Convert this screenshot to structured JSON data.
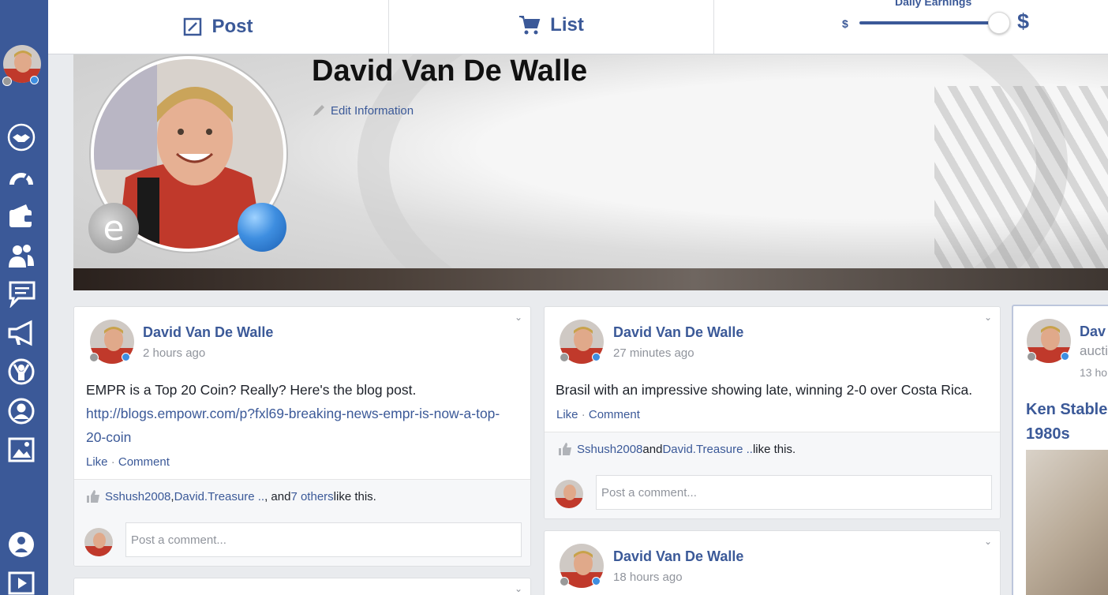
{
  "topbar": {
    "post_label": "Post",
    "list_label": "List",
    "earnings_label": "Daily Earnings",
    "earnings_min": "$",
    "earnings_max": "$",
    "earnings_level": 0.93,
    "accent": "#3b5998"
  },
  "sidebar": {
    "items": [
      {
        "icon": "handshake-icon"
      },
      {
        "icon": "gauge-icon"
      },
      {
        "icon": "wallet-icon"
      },
      {
        "icon": "friends-icon"
      },
      {
        "icon": "chat-icon"
      },
      {
        "icon": "megaphone-icon"
      },
      {
        "icon": "celebrate-icon"
      },
      {
        "icon": "profile-icon"
      },
      {
        "icon": "image-icon"
      },
      {
        "icon": "help-icon"
      },
      {
        "icon": "video-icon"
      }
    ]
  },
  "profile": {
    "name": "David Van De Walle",
    "edit_label": "Edit Information",
    "badge_letter": "e"
  },
  "posts": [
    {
      "author": "David Van De Walle",
      "time": "2 hours ago",
      "text": "EMPR is a Top 20 Coin? Really? Here's the blog post.",
      "link": "http://blogs.empowr.com/p?fxl69-breaking-news-empr-is-now-a-top-20-coin",
      "like": "Like",
      "comment": "Comment",
      "likers_a": "Sshush2008",
      "likers_b": "David.Treasure ..",
      "likers_mid": ", ",
      "likers_and": ", and ",
      "likers_others": "7 others",
      "likers_tail": " like this.",
      "comment_placeholder": "Post a comment..."
    },
    {
      "author": "David Van De Walle",
      "time": "27 minutes ago",
      "text": "Brasil with an impressive showing late, winning 2-0 over Costa Rica.",
      "like": "Like",
      "comment": "Comment",
      "likers_a": "Sshush2008",
      "likers_and": " and ",
      "likers_b": "David.Treasure ..",
      "likers_tail": " like this.",
      "comment_placeholder": "Post a comment..."
    },
    {
      "author": "David Van De Walle",
      "time": "18 hours ago"
    },
    {
      "author": "Dav",
      "time_prefix": "aucti",
      "time": "13 ho",
      "title_line1": "Ken Stable",
      "title_line2": "1980s"
    }
  ]
}
